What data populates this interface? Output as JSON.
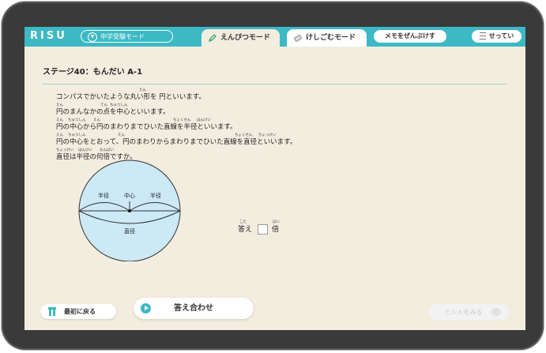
{
  "header": {
    "logo": "RISU",
    "mode_select": "中学受験モード",
    "tab_pencil": "えんぴつモード",
    "tab_eraser": "けしごむモード",
    "memo_button": "メモをぜんぶけす",
    "settings_button": "せってい"
  },
  "stage": {
    "title": "ステージ40：もんだい A-1"
  },
  "question": {
    "lines": [
      {
        "text": "コンパスでかいたような丸い形を 円といいます。",
        "ruby": [
          {
            "text": "えん",
            "pos": 105
          }
        ]
      },
      {
        "text": "円のまんなかの点を中心といいます。",
        "ruby": [
          {
            "text": "えん",
            "pos": 0
          },
          {
            "text": "てん",
            "pos": 56
          },
          {
            "text": "ちゅうしん",
            "pos": 68
          }
        ]
      },
      {
        "text": "円の中心から円のまわりまでひいた直線を半径といいます。",
        "ruby": [
          {
            "text": "えん",
            "pos": 0
          },
          {
            "text": "ちゅうしん",
            "pos": 15
          },
          {
            "text": "えん",
            "pos": 47
          },
          {
            "text": "ちょくせん",
            "pos": 148
          },
          {
            "text": "はんけい",
            "pos": 178
          }
        ]
      },
      {
        "text": "円の中心をとおって、円のまわりからまわりまでひいた直線を直径といいます。",
        "ruby": [
          {
            "text": "えん",
            "pos": 0
          },
          {
            "text": "ちゅうしん",
            "pos": 15
          },
          {
            "text": "えん",
            "pos": 78
          },
          {
            "text": "ちょくせん",
            "pos": 226
          },
          {
            "text": "ちょっけい",
            "pos": 256
          }
        ]
      },
      {
        "text": "直径は半径の何倍ですか。",
        "ruby": [
          {
            "text": "ちょっけい",
            "pos": 0
          },
          {
            "text": "はんけい",
            "pos": 28
          },
          {
            "text": "なんばい",
            "pos": 55
          }
        ]
      }
    ]
  },
  "figure": {
    "label_radius_left": "半径",
    "label_center": "中心",
    "label_radius_right": "半径",
    "label_diameter": "直径",
    "circle_color": "#cce9f5"
  },
  "answer": {
    "label": "答え",
    "label_ruby": "こた",
    "unit": "倍",
    "unit_ruby": "ばい",
    "value": ""
  },
  "footer": {
    "back_button": "最初に戻る",
    "check_button": "答え合わせ",
    "hint_button": "ヒントをみる"
  },
  "colors": {
    "accent": "#3cb9c4",
    "background": "#f3ede0"
  }
}
